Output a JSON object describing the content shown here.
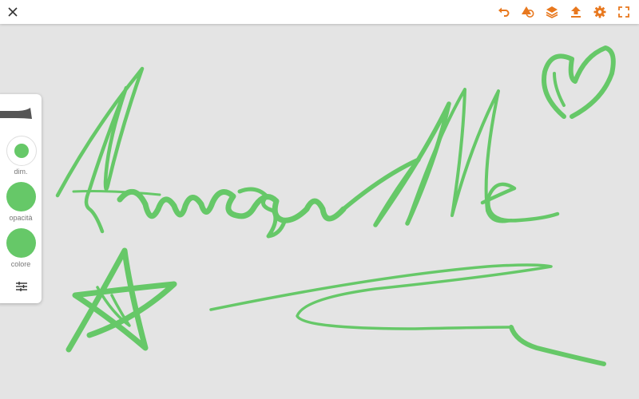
{
  "toolbar": {
    "icons": [
      "close-icon",
      "undo-icon",
      "shape-icon",
      "layers-icon",
      "share-icon",
      "gear-icon",
      "fullscreen-icon"
    ]
  },
  "colors": {
    "accent": "#e8781e",
    "stroke": "#66c868",
    "canvas": "#e4e4e4"
  },
  "brush_panel": {
    "size_label": "dim.",
    "opacity_label": "opacità",
    "color_label": "colore"
  }
}
